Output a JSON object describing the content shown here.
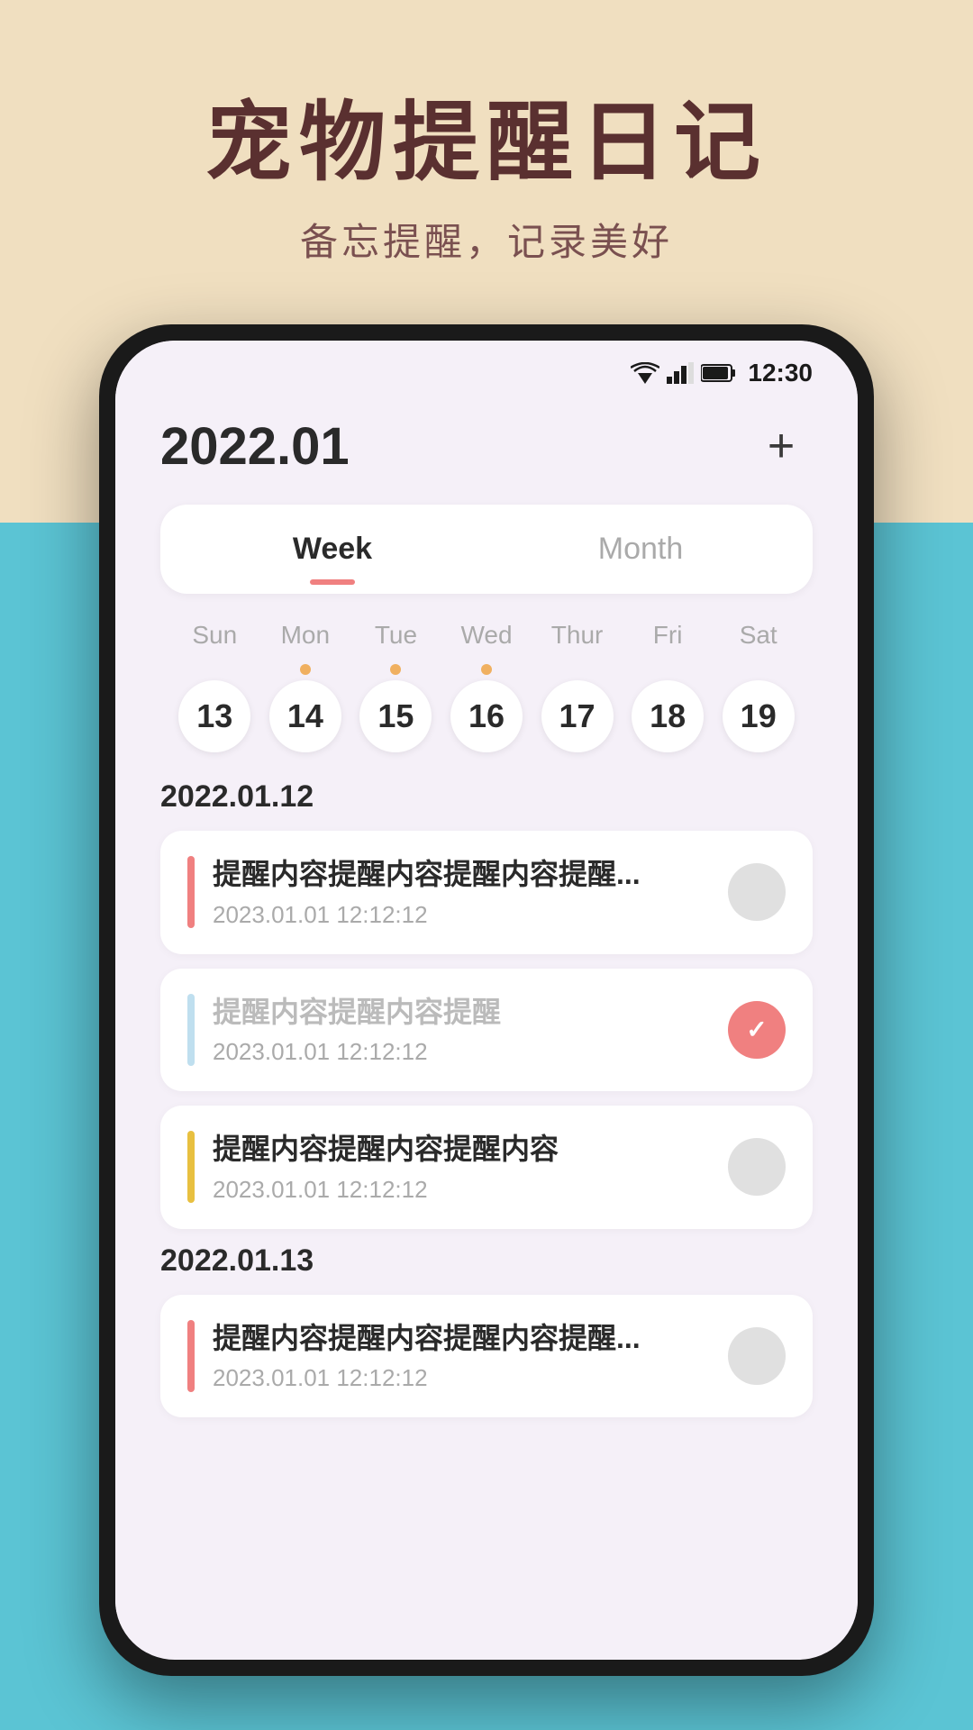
{
  "background": {
    "top_color": "#f0dfc0",
    "bottom_color": "#5bc4d4"
  },
  "app_header": {
    "title": "宠物提醒日记",
    "subtitle": "备忘提醒，记录美好"
  },
  "status_bar": {
    "time": "12:30",
    "wifi_signal": "▼",
    "cell_signal": "▲",
    "battery": "🔋"
  },
  "header": {
    "year_month": "2022.01",
    "add_button_label": "+"
  },
  "tabs": [
    {
      "id": "week",
      "label": "Week",
      "active": true
    },
    {
      "id": "month",
      "label": "Month",
      "active": false
    }
  ],
  "week_days": [
    "Sun",
    "Mon",
    "Tue",
    "Wed",
    "Thur",
    "Fri",
    "Sat"
  ],
  "week_dates": [
    {
      "day": "13",
      "has_dot": false
    },
    {
      "day": "14",
      "has_dot": true
    },
    {
      "day": "15",
      "has_dot": true
    },
    {
      "day": "16",
      "has_dot": true
    },
    {
      "day": "17",
      "has_dot": false
    },
    {
      "day": "18",
      "has_dot": false
    },
    {
      "day": "19",
      "has_dot": false
    }
  ],
  "sections": [
    {
      "date": "2022.01.12",
      "reminders": [
        {
          "id": "r1",
          "accent": "pink",
          "title": "提醒内容提醒内容提醒内容提醒...",
          "time": "2023.01.01  12:12:12",
          "completed": false
        },
        {
          "id": "r2",
          "accent": "blue",
          "title": "提醒内容提醒内容提醒",
          "time": "2023.01.01  12:12:12",
          "completed": true
        },
        {
          "id": "r3",
          "accent": "yellow",
          "title": "提醒内容提醒内容提醒内容",
          "time": "2023.01.01  12:12:12",
          "completed": false
        }
      ]
    },
    {
      "date": "2022.01.13",
      "reminders": [
        {
          "id": "r4",
          "accent": "pink",
          "title": "提醒内容提醒内容提醒内容提醒...",
          "time": "2023.01.01  12:12:12",
          "completed": false
        }
      ]
    }
  ]
}
